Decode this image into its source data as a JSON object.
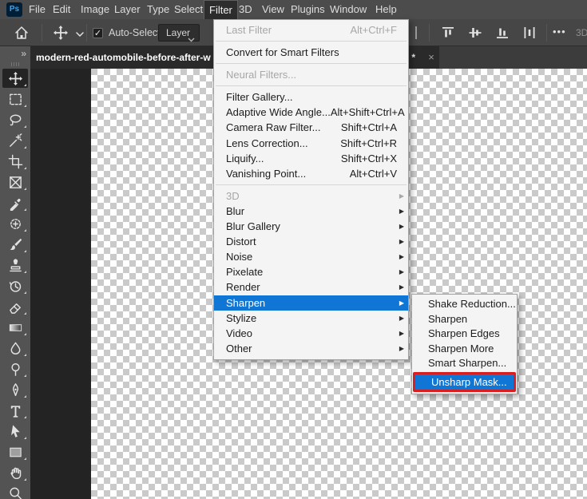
{
  "menubar": {
    "logo_text": "Ps",
    "items": [
      "File",
      "Edit",
      "Image",
      "Layer",
      "Type",
      "Select",
      "Filter",
      "3D",
      "View",
      "Plugins",
      "Window",
      "Help"
    ],
    "active_item": "Filter"
  },
  "options_bar": {
    "auto_select": {
      "label": "Auto-Select:",
      "checked": true,
      "checkmark": "✓"
    },
    "layer_select": {
      "value": "Layer"
    },
    "more_options_glyph": "•••",
    "mode_3d_label": "3D",
    "right_icons": [
      "align-top-edges-icon",
      "align-vertical-centers-icon",
      "align-bottom-edges-icon",
      "distribute-horizontal-centers-icon"
    ]
  },
  "tab_bar": {
    "collapse_glyph": "»",
    "active_tab": {
      "title": "modern-red-automobile-before-after-w",
      "suffix": ") *",
      "close_glyph": "×"
    }
  },
  "toolbar": {
    "tools": [
      {
        "name": "move",
        "selected": true
      },
      {
        "name": "rectangular-marquee"
      },
      {
        "name": "lasso"
      },
      {
        "name": "magic-wand"
      },
      {
        "name": "crop"
      },
      {
        "name": "frame"
      },
      {
        "name": "eyedropper"
      },
      {
        "name": "healing-brush"
      },
      {
        "name": "brush"
      },
      {
        "name": "clone-stamp"
      },
      {
        "name": "history-brush"
      },
      {
        "name": "eraser"
      },
      {
        "name": "gradient"
      },
      {
        "name": "blur"
      },
      {
        "name": "dodge"
      },
      {
        "name": "pen"
      },
      {
        "name": "type"
      },
      {
        "name": "path-selection"
      },
      {
        "name": "rectangle"
      },
      {
        "name": "hand"
      },
      {
        "name": "zoom"
      }
    ]
  },
  "filter_menu": {
    "groups": [
      [
        {
          "label": "Last Filter",
          "shortcut": "Alt+Ctrl+F",
          "disabled": true
        }
      ],
      [
        {
          "label": "Convert for Smart Filters"
        }
      ],
      [
        {
          "label": "Neural Filters...",
          "disabled": true
        }
      ],
      [
        {
          "label": "Filter Gallery..."
        },
        {
          "label": "Adaptive Wide Angle...",
          "shortcut": "Alt+Shift+Ctrl+A"
        },
        {
          "label": "Camera Raw Filter...",
          "shortcut": "Shift+Ctrl+A"
        },
        {
          "label": "Lens Correction...",
          "shortcut": "Shift+Ctrl+R"
        },
        {
          "label": "Liquify...",
          "shortcut": "Shift+Ctrl+X"
        },
        {
          "label": "Vanishing Point...",
          "shortcut": "Alt+Ctrl+V"
        }
      ],
      [
        {
          "label": "3D",
          "submenu": true,
          "disabled": true
        },
        {
          "label": "Blur",
          "submenu": true
        },
        {
          "label": "Blur Gallery",
          "submenu": true
        },
        {
          "label": "Distort",
          "submenu": true
        },
        {
          "label": "Noise",
          "submenu": true
        },
        {
          "label": "Pixelate",
          "submenu": true
        },
        {
          "label": "Render",
          "submenu": true
        },
        {
          "label": "Sharpen",
          "submenu": true,
          "highlighted": true
        },
        {
          "label": "Stylize",
          "submenu": true
        },
        {
          "label": "Video",
          "submenu": true
        },
        {
          "label": "Other",
          "submenu": true
        }
      ]
    ],
    "submenu_arrow_glyph": "▶"
  },
  "sharpen_submenu": {
    "items": [
      {
        "label": "Shake Reduction..."
      },
      {
        "label": "Sharpen"
      },
      {
        "label": "Sharpen Edges"
      },
      {
        "label": "Sharpen More"
      },
      {
        "label": "Smart Sharpen..."
      },
      {
        "label": "Unsharp Mask...",
        "highlighted": true,
        "red_outline": true
      }
    ]
  },
  "colors": {
    "highlight_blue": "#0f76d6",
    "red_outline": "#d81e1e",
    "menu_background": "#f4f4f4",
    "checker_gray": "#cacaca",
    "ps_logo_background": "#001e36",
    "ps_logo_text": "#31a8ff"
  }
}
